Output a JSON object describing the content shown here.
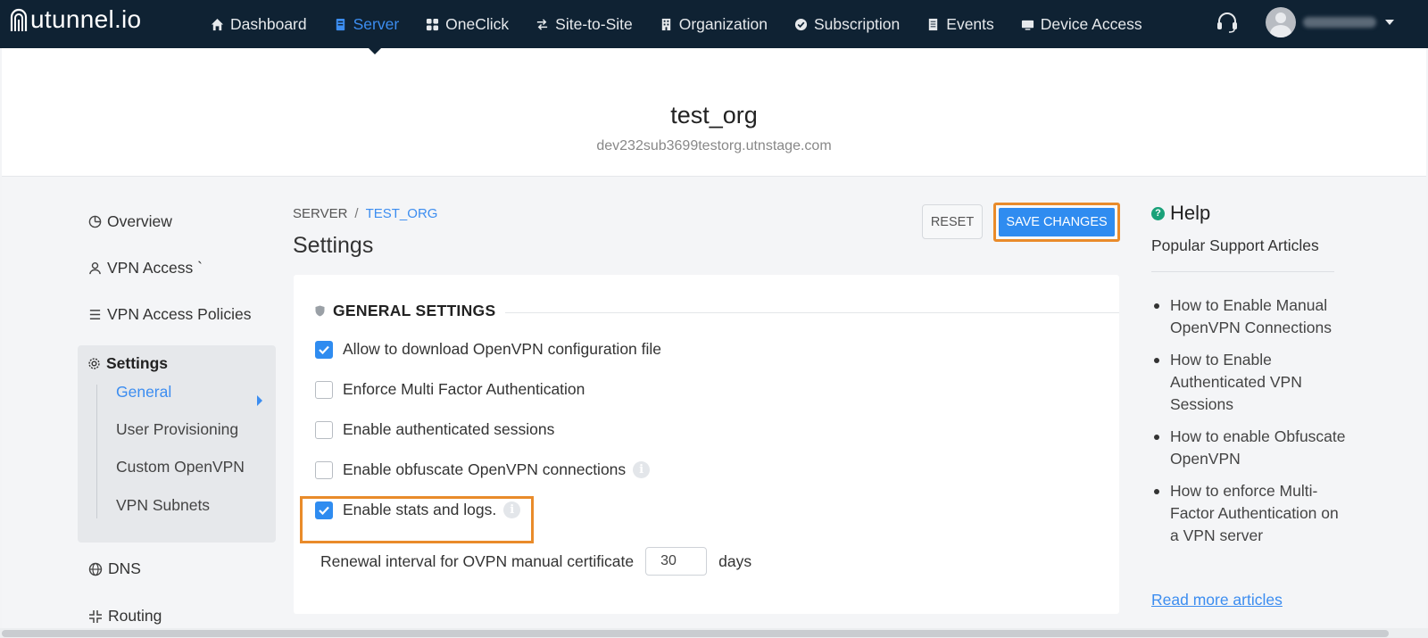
{
  "brand": {
    "logo_text": "utunnel.io"
  },
  "topnav": {
    "items": [
      {
        "label": "Dashboard",
        "icon": "home-icon"
      },
      {
        "label": "Server",
        "icon": "server-icon",
        "active": true
      },
      {
        "label": "OneClick",
        "icon": "grid-icon"
      },
      {
        "label": "Site-to-Site",
        "icon": "arrows-icon"
      },
      {
        "label": "Organization",
        "icon": "building-icon"
      },
      {
        "label": "Subscription",
        "icon": "check-circle-icon"
      },
      {
        "label": "Events",
        "icon": "list-icon"
      },
      {
        "label": "Device Access",
        "icon": "monitor-icon"
      }
    ],
    "support_icon": "headset-icon"
  },
  "header": {
    "org_name": "test_org",
    "domain": "dev232sub3699testorg.utnstage.com"
  },
  "sidebar": {
    "items": [
      {
        "label": "Overview",
        "icon": "pie-icon"
      },
      {
        "label": "VPN Access `",
        "icon": "user-icon"
      },
      {
        "label": "VPN Access Policies",
        "icon": "list-icon"
      }
    ],
    "settings": {
      "label": "Settings",
      "icon": "gear-icon",
      "sub_items": [
        {
          "label": "General",
          "active": true
        },
        {
          "label": "User Provisioning"
        },
        {
          "label": "Custom OpenVPN"
        },
        {
          "label": "VPN Subnets"
        }
      ]
    },
    "after_items": [
      {
        "label": "DNS",
        "icon": "globe-icon"
      },
      {
        "label": "Routing",
        "icon": "routing-icon"
      }
    ]
  },
  "main": {
    "breadcrumb": {
      "root": "SERVER",
      "separator": "/",
      "current": "TEST_ORG"
    },
    "title": "Settings",
    "reset_label": "RESET",
    "save_label": "SAVE CHANGES",
    "section_title": "GENERAL SETTINGS",
    "options": [
      {
        "label": "Allow to download OpenVPN configuration file",
        "checked": true,
        "info": false
      },
      {
        "label": "Enforce Multi Factor Authentication",
        "checked": false,
        "info": false
      },
      {
        "label": "Enable authenticated sessions",
        "checked": false,
        "info": false
      },
      {
        "label": "Enable obfuscate OpenVPN connections",
        "checked": false,
        "info": true
      },
      {
        "label": "Enable stats and logs.",
        "checked": true,
        "info": true
      }
    ],
    "renewal": {
      "label": "Renewal interval for OVPN manual certificate",
      "value": "30",
      "unit": "days"
    }
  },
  "help": {
    "title": "Help",
    "subtitle": "Popular Support Articles",
    "articles": [
      "How to Enable Manual OpenVPN Connections",
      "How to Enable Authenticated VPN Sessions",
      "How to enable Obfuscate OpenVPN",
      "How to enforce Multi-Factor Authentication on a VPN server"
    ],
    "read_more": "Read more articles"
  },
  "colors": {
    "nav_bg": "#0f2233",
    "accent": "#2f8cf0",
    "highlight": "#e98b2a",
    "help_icon": "#1aa179"
  }
}
